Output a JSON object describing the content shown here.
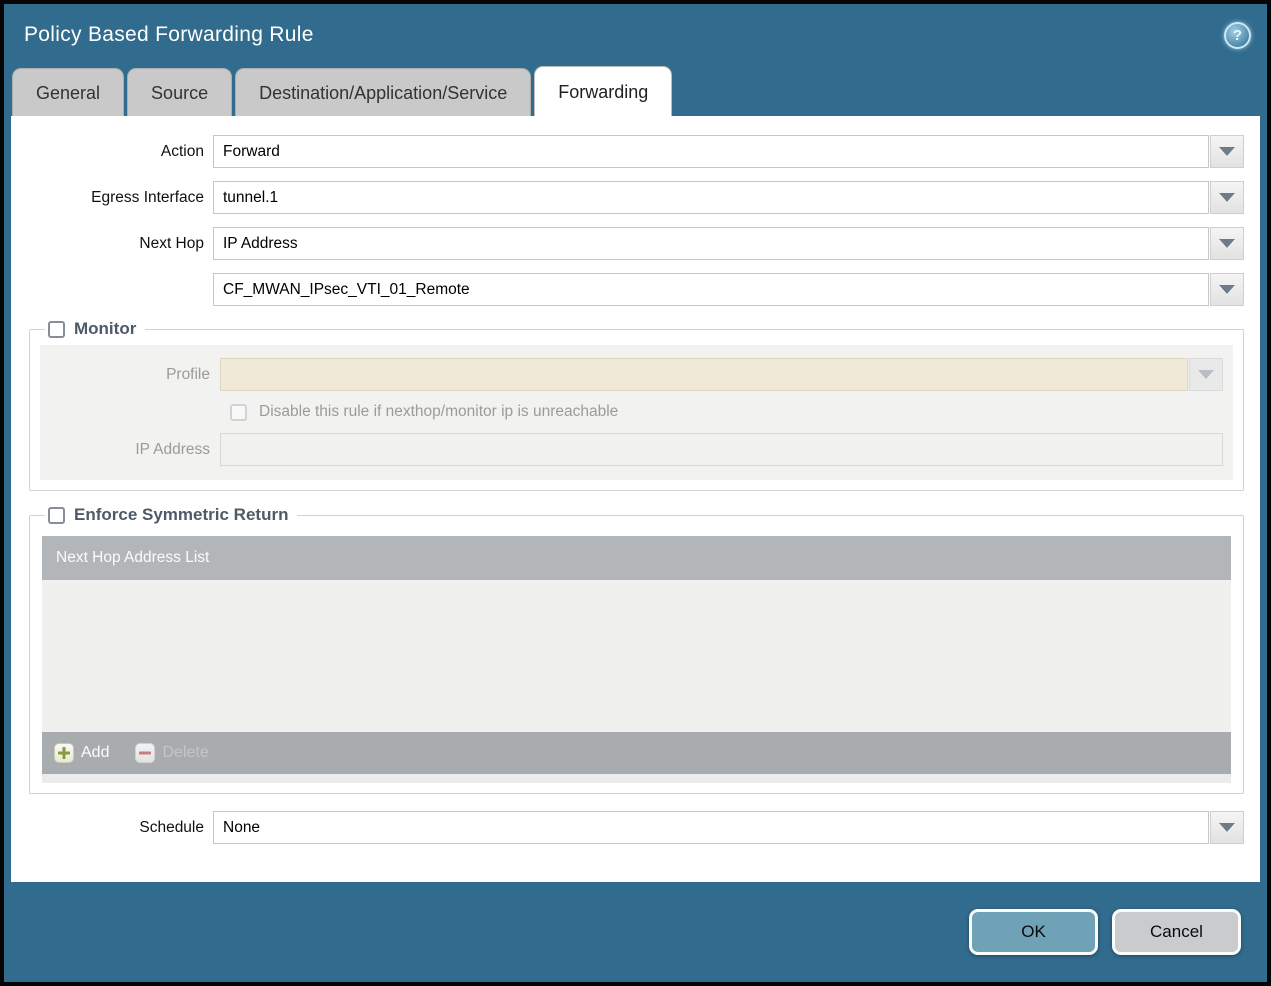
{
  "window": {
    "title": "Policy Based Forwarding Rule",
    "help_glyph": "?"
  },
  "tabs": [
    {
      "label": "General",
      "active": false
    },
    {
      "label": "Source",
      "active": false
    },
    {
      "label": "Destination/Application/Service",
      "active": false
    },
    {
      "label": "Forwarding",
      "active": true
    }
  ],
  "form": {
    "action": {
      "label": "Action",
      "value": "Forward"
    },
    "egress_interface": {
      "label": "Egress Interface",
      "value": "tunnel.1"
    },
    "next_hop": {
      "label": "Next Hop",
      "value": "IP Address"
    },
    "next_hop_address": {
      "value": "CF_MWAN_IPsec_VTI_01_Remote"
    },
    "schedule": {
      "label": "Schedule",
      "value": "None"
    }
  },
  "monitor": {
    "legend": "Monitor",
    "checked": false,
    "profile_label": "Profile",
    "profile_value": "",
    "disable_rule_label": "Disable this rule if nexthop/monitor ip is unreachable",
    "disable_rule_checked": false,
    "ip_address_label": "IP Address",
    "ip_address_value": ""
  },
  "symmetric_return": {
    "legend": "Enforce Symmetric Return",
    "checked": false,
    "table_header": "Next Hop Address List",
    "rows": [],
    "add_label": "Add",
    "delete_label": "Delete",
    "delete_enabled": false
  },
  "footer": {
    "ok_label": "OK",
    "cancel_label": "Cancel"
  },
  "colors": {
    "titlebar": "#316C8E",
    "active_tab": "#FFFFFF",
    "inactive_tab": "#C9C9C9",
    "table_header_bg": "#B3B6B8",
    "disabled_field_beige": "#F0E9D7",
    "disabled_panel": "#F2F2F0",
    "ok_button": "#6FA2B7",
    "cancel_button": "#C9CBCD",
    "add_plus": "#8A9A3F",
    "delete_minus": "#C57F7F",
    "legend_text": "#4E5A67"
  }
}
